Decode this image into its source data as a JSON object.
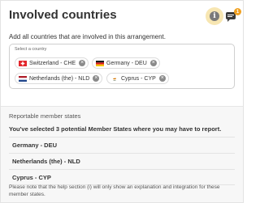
{
  "header": {
    "title": "Involved countries",
    "info_icon": "info-icon",
    "info_glyph": "i",
    "chat_icon": "chat-icon",
    "notification_count": "1",
    "accent_color": "#f0a020"
  },
  "instruction": "Add all countries that are involved in this arrangement.",
  "country_select": {
    "label": "Select a country",
    "chips": [
      {
        "label": "Switzerland - CHE",
        "flag": "switzerland-flag"
      },
      {
        "label": "Germany - DEU",
        "flag": "germany-flag"
      },
      {
        "label": "Netherlands (the) - NLD",
        "flag": "netherlands-flag"
      },
      {
        "label": "Cyprus - CYP",
        "flag": "cyprus-flag"
      }
    ],
    "remove_glyph": "×"
  },
  "reportable": {
    "title": "Reportable member states",
    "summary": "You've selected 3 potential Member States where you may have to report.",
    "states": [
      "Germany - DEU",
      "Netherlands (the) - NLD",
      "Cyprus - CYP"
    ],
    "note": "Please note that the help section (i) will only show an explanation and integration for these member states."
  }
}
